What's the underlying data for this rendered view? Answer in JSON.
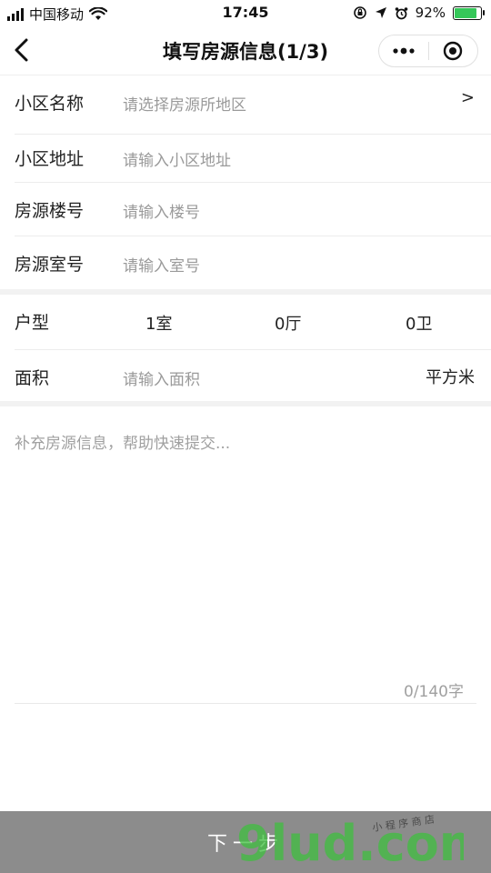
{
  "status_bar": {
    "carrier": "中国移动",
    "time": "17:45",
    "battery": "92%",
    "battery_level": 0.92,
    "battery_color": "#35c759"
  },
  "nav": {
    "title": "填写房源信息(1/3)",
    "back_icon": "chevron-left-icon",
    "more_icon": "more-dots-icon",
    "close_icon": "target-circle-icon"
  },
  "form": {
    "community_name": {
      "label": "小区名称",
      "placeholder": "请选择房源所地区",
      "arrow": ">"
    },
    "community_address": {
      "label": "小区地址",
      "placeholder": "请输入小区地址"
    },
    "building_no": {
      "label": "房源楼号",
      "placeholder": "请输入楼号"
    },
    "room_no": {
      "label": "房源室号",
      "placeholder": "请输入室号"
    },
    "layout": {
      "label": "户型",
      "rooms": "1室",
      "halls": "0厅",
      "baths": "0卫"
    },
    "area": {
      "label": "面积",
      "placeholder": "请输入面积",
      "unit": "平方米"
    },
    "notes": {
      "placeholder": "补充房源信息，帮助快速提交...",
      "counter": "0/140字"
    }
  },
  "footer": {
    "next_label": "下一步"
  },
  "watermark": {
    "text": "9lud.com",
    "tagline": "小 程 序 商 店"
  },
  "colors": {
    "button_bg": "#8c8c8c",
    "watermark_green": "#3fbf3f",
    "watermark_orange": "#f39a1e"
  }
}
